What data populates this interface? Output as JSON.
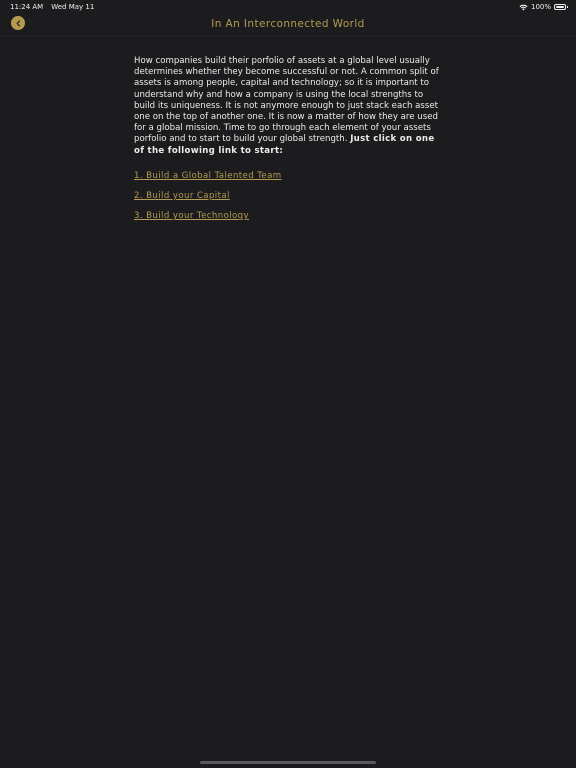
{
  "status_bar": {
    "time": "11:24 AM",
    "date": "Wed May 11",
    "battery_percent": "100%"
  },
  "nav": {
    "title": "In An Interconnected World",
    "back_icon": "chevron-left-icon"
  },
  "body": {
    "intro_text": "How companies build their porfolio of assets at a global level usually determines whether they become successful or not. A common split of assets is among people, capital and technology; so it is important to understand why and how a company is using the local strengths to build its uniqueness. It is not anymore enough to just stack each asset one on the top of another one. It is now a matter of how they are used for a global mission. Time to go through each element of your assets porfolio and to start to build your global strength. ",
    "intro_bold": "Just click on one of the following link to start:",
    "links": [
      {
        "label": "1. Build a Global Talented Team"
      },
      {
        "label": "2. Build your Capital"
      },
      {
        "label": "3. Build your Technology"
      }
    ]
  },
  "colors": {
    "accent": "#b59b4f",
    "background": "#1c1c1e",
    "text": "#ececec"
  }
}
